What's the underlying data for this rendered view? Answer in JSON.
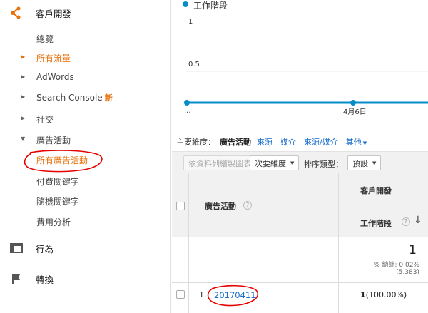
{
  "sidebar": {
    "acquisition": {
      "label": "客戶開發",
      "icon": "acquisition-icon"
    },
    "items": [
      {
        "label": "總覽"
      },
      {
        "label": "所有流量"
      },
      {
        "label": "AdWords"
      },
      {
        "label": "Search Console",
        "badge": "新"
      },
      {
        "label": "社交"
      },
      {
        "label": "廣告活動"
      },
      {
        "label": "所有廣告活動"
      },
      {
        "label": "付費關鍵字"
      },
      {
        "label": "隨機關鍵字"
      },
      {
        "label": "費用分析"
      }
    ],
    "behavior": {
      "label": "行為",
      "icon": "behavior-icon"
    },
    "conversions": {
      "label": "轉換",
      "icon": "flag-icon"
    }
  },
  "chart_data": {
    "type": "line",
    "series": [
      {
        "name": "工作階段",
        "color": "#058dc7",
        "values": [
          0,
          0,
          0
        ]
      }
    ],
    "x": [
      "...",
      "4月6日",
      ""
    ],
    "yticks": [
      "1",
      "0.5"
    ],
    "ylim": [
      0,
      1
    ],
    "grid": true
  },
  "dimensions": {
    "primary_label": "主要維度：",
    "current": "廣告活動",
    "links": [
      "來源",
      "媒介",
      "來源/媒介"
    ],
    "other": "其他"
  },
  "toolbar": {
    "plot_rows": "依資料列繪製圖表",
    "secondary": "次要維度",
    "sort_label": "排序類型：",
    "sort_value": "預設"
  },
  "table": {
    "col_campaign": "廣告活動",
    "group_header": "客戶開發",
    "col_sessions": "工作階段",
    "help": "?",
    "sort_arrow": "↓",
    "total_value": "1",
    "total_pct": "% 總計: 0.02%",
    "total_of": "(5,383)",
    "row_index": "1.",
    "row_name": "20170411",
    "row_value": "1",
    "row_pct": "(100.00%)"
  },
  "colors": {
    "accent": "#e8710a",
    "link": "#1a6dcc",
    "series": "#058dc7",
    "annotation": "#e60000"
  }
}
